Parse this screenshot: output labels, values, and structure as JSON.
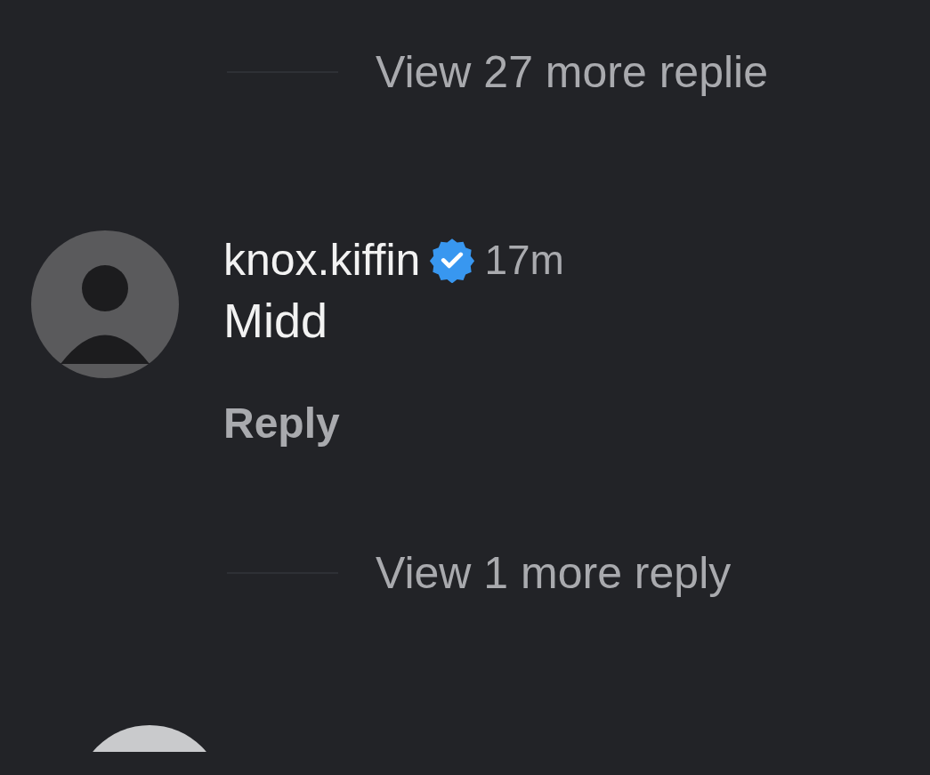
{
  "top_toggle": {
    "label": "View 27 more replie"
  },
  "comment": {
    "username": "knox.kiffin",
    "verified": true,
    "time": "17m",
    "text": "Midd",
    "reply_label": "Reply"
  },
  "bottom_toggle": {
    "label": "View 1 more reply"
  }
}
